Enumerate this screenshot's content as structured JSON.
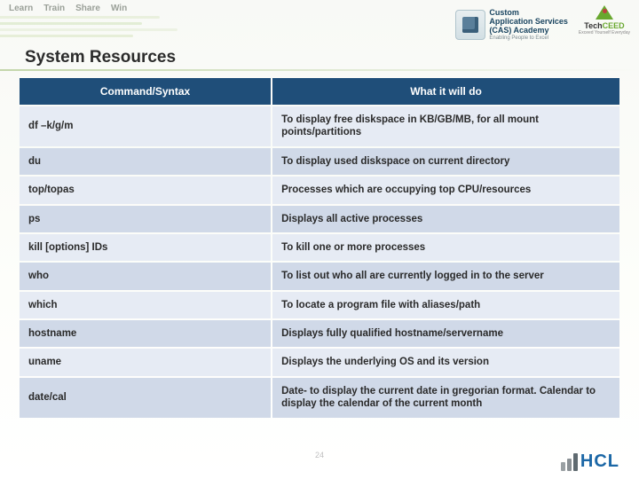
{
  "banner": {
    "words": [
      "Learn",
      "Train",
      "Share",
      "Win"
    ],
    "cas": {
      "line1": "Custom",
      "line2": "Application Services",
      "line3": "(CAS) Academy",
      "tag": "Enabling People to Excel"
    },
    "techceed": {
      "name_a": "Tech",
      "name_b": "CEED",
      "tag": "Exceed Yourself Everyday"
    }
  },
  "title": "System Resources",
  "table": {
    "headers": [
      "Command/Syntax",
      "What it will do"
    ],
    "rows": [
      {
        "cmd": "df –k/g/m",
        "desc": "To display free diskspace in KB/GB/MB, for all mount points/partitions"
      },
      {
        "cmd": "du",
        "desc": "To display used diskspace on current directory"
      },
      {
        "cmd": "top/topas",
        "desc": "Processes which are occupying top CPU/resources"
      },
      {
        "cmd": "ps",
        "desc": "Displays all active processes"
      },
      {
        "cmd": "kill [options] IDs",
        "desc": "To kill one or more processes"
      },
      {
        "cmd": "who",
        "desc": "To list out who all are currently logged in to the server"
      },
      {
        "cmd": "which",
        "desc": "To locate a program file with aliases/path"
      },
      {
        "cmd": "hostname",
        "desc": "Displays fully qualified hostname/servername"
      },
      {
        "cmd": "uname",
        "desc": "Displays the underlying OS and its version"
      },
      {
        "cmd": "date/cal",
        "desc": "Date- to display the current date in gregorian format. Calendar to display the calendar of the current month"
      }
    ]
  },
  "page_number": "24",
  "footer_brand": "HCL"
}
